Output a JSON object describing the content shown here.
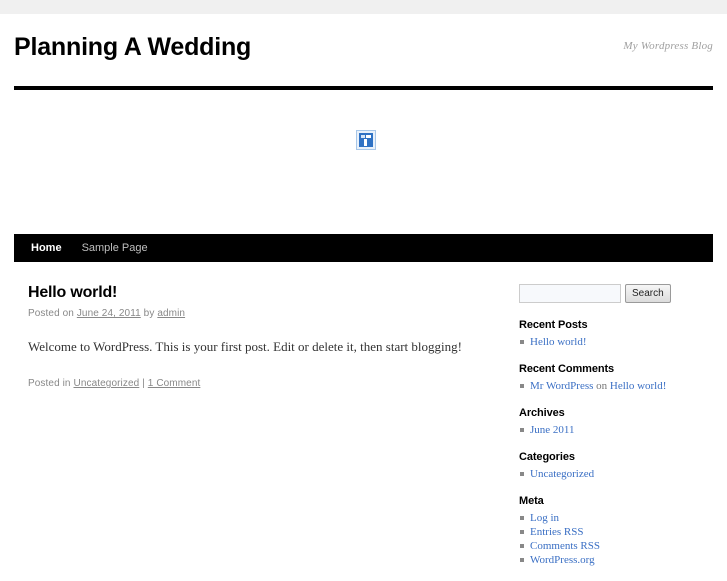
{
  "site": {
    "title": "Planning A Wedding",
    "description": "My Wordpress Blog",
    "header_image_alt": "broken-image"
  },
  "nav": {
    "items": [
      {
        "label": "Home",
        "current": true
      },
      {
        "label": "Sample Page",
        "current": false
      }
    ]
  },
  "post": {
    "title": "Hello world!",
    "meta_posted_on": "Posted on",
    "meta_date": "June 24, 2011",
    "meta_by": "by",
    "meta_author": "admin",
    "body": "Welcome to WordPress. This is your first post. Edit or delete it, then start blogging!",
    "footer_posted_in": "Posted in",
    "footer_category": "Uncategorized",
    "footer_separator": "|",
    "footer_comments": "1 Comment"
  },
  "search": {
    "value": "",
    "placeholder": "",
    "button_label": "Search"
  },
  "sidebar": {
    "widgets": [
      {
        "title": "Recent Posts",
        "items": [
          {
            "link": "Hello world!"
          }
        ]
      },
      {
        "title": "Recent Comments",
        "items": [
          {
            "link": "Mr WordPress",
            "middle": "on",
            "link2": "Hello world!"
          }
        ]
      },
      {
        "title": "Archives",
        "items": [
          {
            "link": "June 2011"
          }
        ]
      },
      {
        "title": "Categories",
        "items": [
          {
            "link": "Uncategorized"
          }
        ]
      },
      {
        "title": "Meta",
        "items": [
          {
            "link": "Log in"
          },
          {
            "link": "Entries RSS"
          },
          {
            "link": "Comments RSS"
          },
          {
            "link": "WordPress.org"
          }
        ]
      }
    ]
  },
  "colors": {
    "link": "#3a6fc4",
    "nav_bg": "#000000",
    "chrome": "#f0f0f0"
  }
}
